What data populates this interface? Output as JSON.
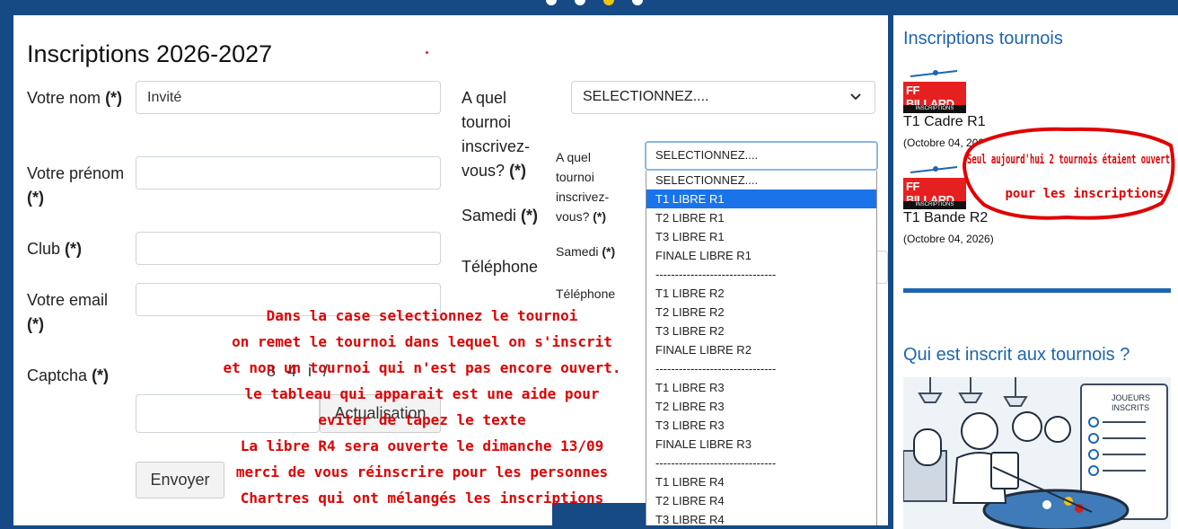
{
  "form": {
    "title": "Inscriptions 2026-2027",
    "required_mark": "(*)",
    "name_label": "Votre nom",
    "name_value": "Invité",
    "firstname_label": "Votre prénom",
    "club_label": "Club",
    "email_label": "Votre email",
    "captcha_label": "Captcha",
    "captcha_text": "8 4 i /",
    "refresh_label": "Actualisation",
    "submit_label": "Envoyer",
    "tournament_label": "A quel tournoi inscrivez-vous?",
    "select_value": "SELECTIONNEZ....",
    "saturday_label": "Samedi",
    "phone_label": "Téléphone"
  },
  "overlay": {
    "tournament_label": "A quel tournoi inscrivez-vous?",
    "saturday_label": "Samedi",
    "phone_label": "Téléphone",
    "select_value": "SELECTIONNEZ....",
    "options": [
      {
        "label": "SELECTIONNEZ....",
        "selected": false
      },
      {
        "label": "T1 LIBRE R1",
        "selected": true
      },
      {
        "label": "T2 LIBRE R1",
        "selected": false
      },
      {
        "label": "T3 LIBRE R1",
        "selected": false
      },
      {
        "label": "FINALE LIBRE R1",
        "selected": false
      },
      {
        "label": "-------------------------------",
        "selected": false
      },
      {
        "label": "T1 LIBRE R2",
        "selected": false
      },
      {
        "label": "T2 LIBRE R2",
        "selected": false
      },
      {
        "label": "T3 LIBRE R2",
        "selected": false
      },
      {
        "label": "FINALE LIBRE R2",
        "selected": false
      },
      {
        "label": "-------------------------------",
        "selected": false
      },
      {
        "label": "T1 LIBRE R3",
        "selected": false
      },
      {
        "label": "T2 LIBRE R3",
        "selected": false
      },
      {
        "label": "T3 LIBRE R3",
        "selected": false
      },
      {
        "label": "FINALE LIBRE R3",
        "selected": false
      },
      {
        "label": "-------------------------------",
        "selected": false
      },
      {
        "label": "T1 LIBRE R4",
        "selected": false
      },
      {
        "label": "T2 LIBRE R4",
        "selected": false
      },
      {
        "label": "T3 LIBRE R4",
        "selected": false
      }
    ]
  },
  "annotations": {
    "instructions": [
      "Dans la case selectionnez le tournoi",
      "on remet le tournoi dans lequel on s'inscrit",
      "et non un tournoi qui n'est pas encore ouvert.",
      "le tableau qui apparait est une aide pour",
      "eviter de tapez le texte",
      "La libre R4 sera ouverte le dimanche 13/09",
      "merci de vous réinscrire pour les personnes",
      "Chartres qui ont mélangés les inscriptions"
    ],
    "bubble_line1": "Seul aujourd'hui 2 tournois étaient ouvert",
    "bubble_line2": "pour les inscriptions"
  },
  "sidebar": {
    "tournaments_title": "Inscriptions tournois",
    "logo_text": "FF BILLARD",
    "logo_sub": "INSCRIPTIONS",
    "tournaments": [
      {
        "name": "T1 Cadre R1",
        "date": "(Octobre 04, 2026)"
      },
      {
        "name": "T1 Bande R2",
        "date": "(Octobre 04, 2026)"
      }
    ],
    "registered_title": "Qui est inscrit aux tournois ?",
    "poster_line1": "JOUEURS",
    "poster_line2": "INSCRITS"
  },
  "colors": {
    "background": "#154a84",
    "accent": "#1d66b0",
    "selected_option": "#1a73e8",
    "annotation": "#e00000"
  }
}
